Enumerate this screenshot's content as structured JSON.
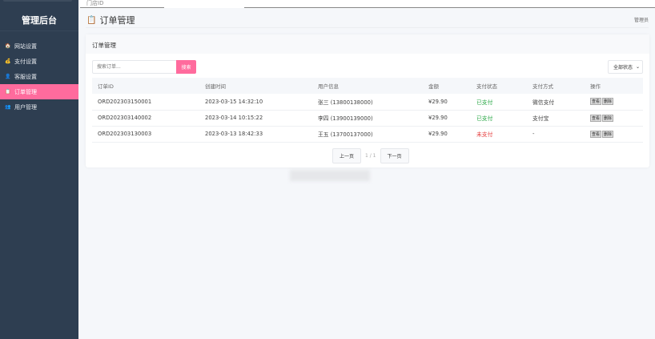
{
  "sidebar": {
    "brand": "管理后台",
    "items": [
      {
        "label": "网站设置",
        "icon": "home-icon"
      },
      {
        "label": "支付设置",
        "icon": "coin-icon"
      },
      {
        "label": "客服设置",
        "icon": "person-icon"
      },
      {
        "label": "订单管理",
        "icon": "clipboard-icon",
        "active": true
      },
      {
        "label": "用户管理",
        "icon": "users-icon"
      }
    ]
  },
  "top_overlay": {
    "label": "门店ID"
  },
  "header": {
    "title": "订单管理",
    "user": "管理员"
  },
  "card": {
    "title": "订单管理",
    "search": {
      "placeholder": "搜索订单...",
      "button": "搜索"
    },
    "status_filter": {
      "selected": "全部状态"
    },
    "columns": [
      "订单ID",
      "创建时间",
      "用户信息",
      "金额",
      "支付状态",
      "支付方式",
      "操作"
    ],
    "rows": [
      {
        "id": "ORD202303150001",
        "time": "2023-03-15 14:32:10",
        "user": "张三 (13800138000)",
        "amount": "¥29.90",
        "status": "已支付",
        "status_type": "paid",
        "method": "微信支付"
      },
      {
        "id": "ORD202303140002",
        "time": "2023-03-14 10:15:22",
        "user": "李四 (13900139000)",
        "amount": "¥29.90",
        "status": "已支付",
        "status_type": "paid",
        "method": "支付宝"
      },
      {
        "id": "ORD202303130003",
        "time": "2023-03-13 18:42:33",
        "user": "王五 (13700137000)",
        "amount": "¥29.90",
        "status": "未支付",
        "status_type": "unpaid",
        "method": "-"
      }
    ],
    "actions": {
      "view": "查看",
      "delete": "删除"
    },
    "pagination": {
      "prev": "上一页",
      "info": "1 / 1",
      "next": "下一页"
    }
  },
  "colors": {
    "sidebar": "#2e3e51",
    "accent": "#ff6b9d",
    "paid": "#28a745",
    "unpaid": "#e53e3e"
  }
}
